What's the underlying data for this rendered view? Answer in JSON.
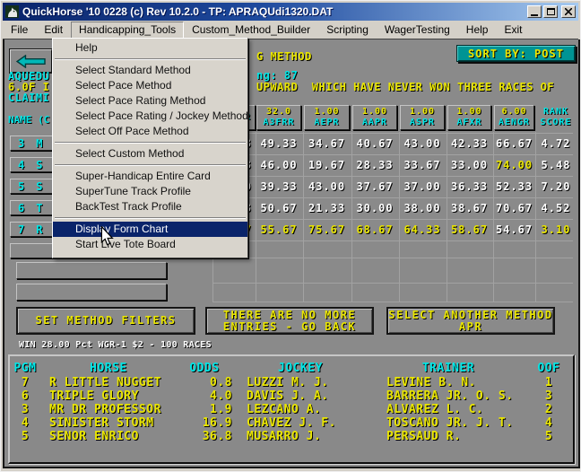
{
  "window": {
    "title": "QuickHorse '10 0228 (c) Rev 10.2.0 - TP: APRAQUdi1320.DAT"
  },
  "menu_bar": {
    "active": "Handicapping_Tools",
    "items": [
      "File",
      "Edit",
      "Handicapping_Tools",
      "Custom_Method_Builder",
      "Scripting",
      "WagerTesting",
      "Help",
      "Exit"
    ]
  },
  "dropdown": {
    "items": [
      {
        "label": "Help"
      },
      {
        "sep": true
      },
      {
        "label": "Select Standard Method"
      },
      {
        "label": "Select Pace Method"
      },
      {
        "label": "Select Pace Rating Method"
      },
      {
        "label": "Select Pace Rating / Jockey Method"
      },
      {
        "label": "Select Off Pace Method"
      },
      {
        "sep": true
      },
      {
        "label": "Select Custom Method"
      },
      {
        "sep": true
      },
      {
        "label": "Super-Handicap Entire Card"
      },
      {
        "label": "SuperTune Track Profile"
      },
      {
        "label": "BackTest Track Profile"
      },
      {
        "sep": true
      },
      {
        "label": "Display Form Chart",
        "highlighted": true
      },
      {
        "label": "Start Live Tote Board"
      }
    ]
  },
  "top": {
    "left_fragments": [
      "AQUEDU",
      "6.0F I",
      "CLAIMI"
    ],
    "right_fragment_line1": "G METHOD",
    "right_fragment_line2": "ng: 87",
    "condition_line": "UPWARD  WHICH HAVE NEVER WON THREE RACES OF",
    "sort_button": "SORT BY: POST"
  },
  "table": {
    "name_header_fragment": "NAME (C",
    "columns": [
      {
        "top": "",
        "code": "R",
        "partial": true
      },
      {
        "top": "32.0",
        "code": "A3FRR"
      },
      {
        "top": "1.00",
        "code": "AEPR"
      },
      {
        "top": "1.00",
        "code": "AAPR"
      },
      {
        "top": "1.00",
        "code": "ASPR"
      },
      {
        "top": "1.00",
        "code": "AFXR"
      },
      {
        "top": "6.00",
        "code": "AENGR"
      },
      {
        "top": "RANK",
        "code": "SCORE",
        "plain": true
      }
    ],
    "rows": [
      {
        "num": "3",
        "name_fragment": "M",
        "cells": [
          {
            "v": "3"
          },
          {
            "v": "49.33"
          },
          {
            "v": "34.67"
          },
          {
            "v": "40.67"
          },
          {
            "v": "43.00"
          },
          {
            "v": "42.33"
          },
          {
            "v": "66.67"
          },
          {
            "v": "4.72"
          }
        ]
      },
      {
        "num": "4",
        "name_fragment": "S",
        "cells": [
          {
            "v": "3"
          },
          {
            "v": "46.00"
          },
          {
            "v": "19.67"
          },
          {
            "v": "28.33"
          },
          {
            "v": "33.67"
          },
          {
            "v": "33.00"
          },
          {
            "v": "74.00",
            "y": true
          },
          {
            "v": "5.48"
          }
        ]
      },
      {
        "num": "5",
        "name_fragment": "S",
        "cells": [
          {
            "v": "0"
          },
          {
            "v": "39.33"
          },
          {
            "v": "43.00"
          },
          {
            "v": "37.67"
          },
          {
            "v": "37.00"
          },
          {
            "v": "36.33"
          },
          {
            "v": "52.33"
          },
          {
            "v": "7.20"
          }
        ]
      },
      {
        "num": "6",
        "name_fragment": "T",
        "cells": [
          {
            "v": "3"
          },
          {
            "v": "50.67"
          },
          {
            "v": "21.33"
          },
          {
            "v": "30.00"
          },
          {
            "v": "38.00"
          },
          {
            "v": "38.67"
          },
          {
            "v": "70.67"
          },
          {
            "v": "4.52"
          }
        ]
      },
      {
        "num": "7",
        "name_fragment": "R",
        "cells": [
          {
            "v": "7",
            "y": true
          },
          {
            "v": "55.67",
            "y": true
          },
          {
            "v": "75.67",
            "y": true
          },
          {
            "v": "68.67",
            "y": true
          },
          {
            "v": "64.33",
            "y": true
          },
          {
            "v": "58.67",
            "y": true
          },
          {
            "v": "54.67"
          },
          {
            "v": "3.10",
            "y": true
          }
        ]
      },
      {
        "num": "",
        "name_fragment": ""
      }
    ]
  },
  "actions": {
    "set_filters": "SET METHOD FILTERS",
    "no_more_line1": "THERE ARE NO MORE",
    "no_more_line2": "ENTRIES - GO BACK",
    "select_another_line1": "SELECT ANOTHER METHOD",
    "select_another_line2": "APR"
  },
  "status_line": "WIN 28.00 Pct WGR-1 $2 - 100 RACES",
  "results_panel": {
    "headers": [
      "PGM",
      "HORSE",
      "ODDS",
      "JOCKEY",
      "TRAINER",
      "OOF"
    ],
    "rows": [
      [
        "7",
        "R LITTLE NUGGET",
        "0.8",
        "LUZZI M. J.",
        "LEVINE B. N.",
        "1"
      ],
      [
        "6",
        "TRIPLE GLORY",
        "4.0",
        "DAVIS J. A.",
        "BARRERA JR. O. S.",
        "3"
      ],
      [
        "3",
        "MR DR PROFESSOR",
        "1.9",
        "LEZCANO A.",
        "ALVAREZ L. C.",
        "2"
      ],
      [
        "4",
        "SINISTER STORM",
        "16.9",
        "CHAVEZ J. F.",
        "TOSCANO JR. J. T.",
        "4"
      ],
      [
        "5",
        "SENOR ENRICO",
        "36.8",
        "MUSARRO J.",
        "PERSAUD R.",
        "5"
      ]
    ]
  },
  "colors": {
    "cyan": "#00e6e6",
    "yellow": "#eae600",
    "teal_button": "#009494",
    "highlight_blue": "#0a246a",
    "client_gray": "#8a8a8a"
  }
}
